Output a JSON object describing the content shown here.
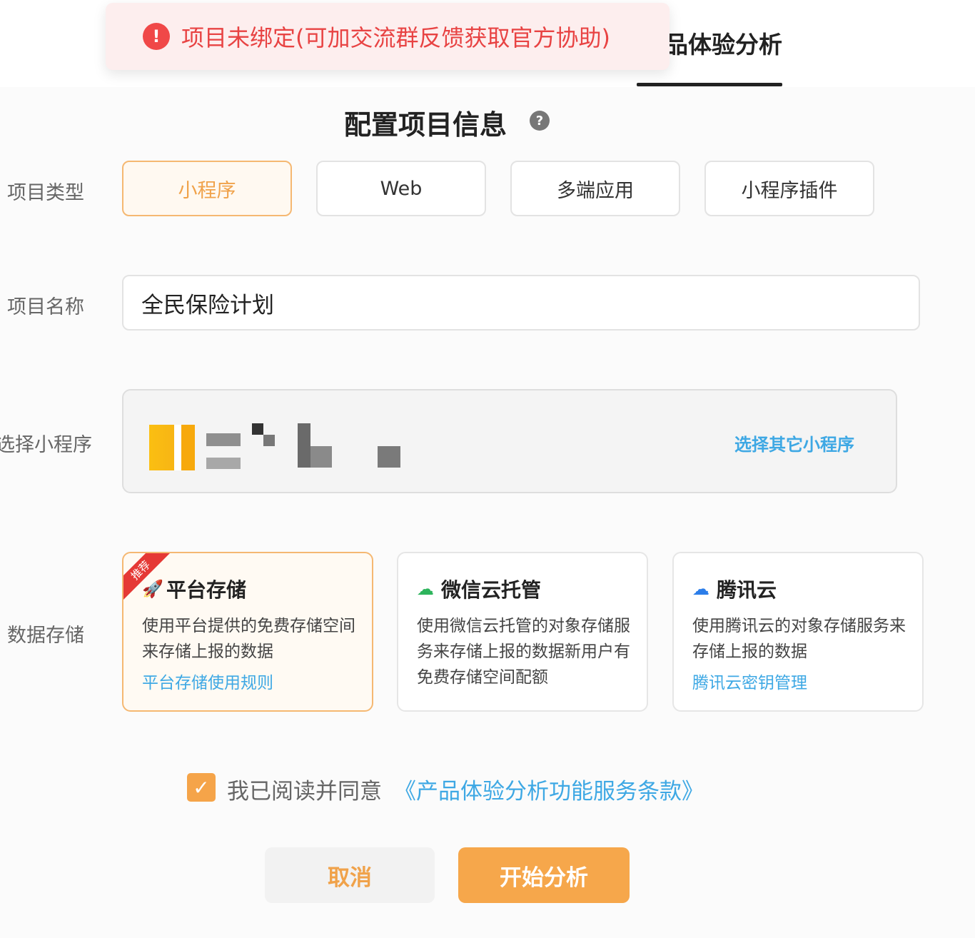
{
  "header": {
    "tab_title": "品体验分析"
  },
  "toast": {
    "icon": "!",
    "message": "项目未绑定(可加交流群反馈获取官方协助)"
  },
  "form": {
    "section_title": "配置项目信息",
    "help_icon": "?",
    "project_type": {
      "label": "项目类型",
      "options": [
        "小程序",
        "Web",
        "多端应用",
        "小程序插件"
      ],
      "selected": "小程序"
    },
    "project_name": {
      "label": "项目名称",
      "value": "全民保险计划"
    },
    "mini_program": {
      "label": "选择小程序",
      "select_other": "选择其它小程序"
    },
    "storage": {
      "label": "数据存储",
      "cards": [
        {
          "badge": "推荐",
          "title": "平台存储",
          "desc": "使用平台提供的免费存储空间来存储上报的数据",
          "link": "平台存储使用规则"
        },
        {
          "title": "微信云托管",
          "desc": "使用微信云托管的对象存储服务来存储上报的数据新用户有免费存储空间配额"
        },
        {
          "title": "腾讯云",
          "desc": "使用腾讯云的对象存储服务来存储上报的数据",
          "link": "腾讯云密钥管理"
        }
      ]
    },
    "agreement": {
      "checked": true,
      "checkmark": "✓",
      "text": "我已阅读并同意",
      "link": "《产品体验分析功能服务条款》"
    },
    "buttons": {
      "cancel": "取消",
      "start": "开始分析"
    }
  },
  "colors": {
    "accent": "#f6a74b",
    "link": "#3ea8e4",
    "error": "#e84343"
  }
}
